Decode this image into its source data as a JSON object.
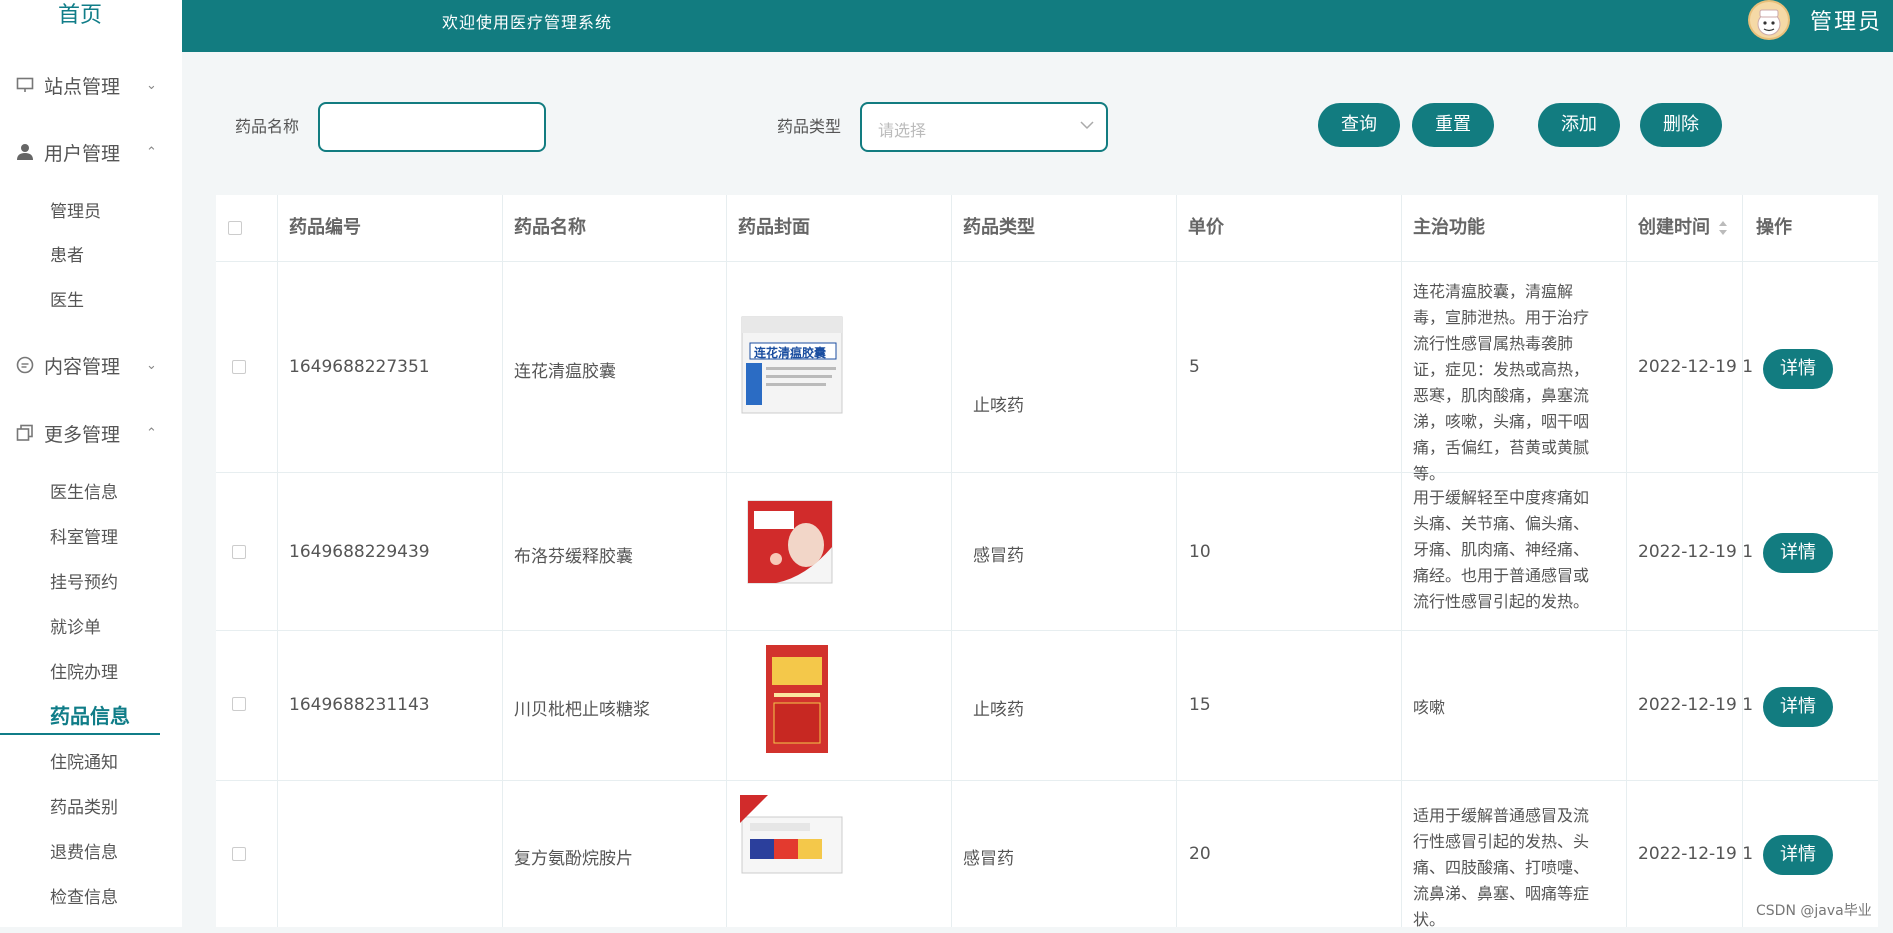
{
  "sidebar": {
    "title": "首页",
    "groups": [
      {
        "label": "站点管理",
        "icon": "monitor-icon",
        "chevron": "⌄"
      },
      {
        "label": "用户管理",
        "icon": "user-icon",
        "chevron": "⌃"
      },
      {
        "label": "内容管理",
        "icon": "chat-icon",
        "chevron": "⌄"
      },
      {
        "label": "更多管理",
        "icon": "copy-icon",
        "chevron": "⌃"
      }
    ],
    "user_items": [
      "管理员",
      "患者",
      "医生"
    ],
    "more_items": [
      "医生信息",
      "科室管理",
      "挂号预约",
      "就诊单",
      "住院办理",
      "药品信息",
      "住院通知",
      "药品类别",
      "退费信息",
      "检查信息"
    ]
  },
  "topbar": {
    "welcome": "欢迎使用医疗管理系统",
    "admin_name": "管理员"
  },
  "search": {
    "name_label": "药品名称",
    "name_value": "",
    "type_label": "药品类型",
    "type_placeholder": "请选择",
    "query": "查询",
    "reset": "重置",
    "add": "添加",
    "delete": "删除"
  },
  "table": {
    "headers": [
      "药品编号",
      "药品名称",
      "药品封面",
      "药品类型",
      "单价",
      "主治功能",
      "创建时间",
      "操作"
    ],
    "rows": [
      {
        "id": "1649688227351",
        "name": "连花清瘟胶囊",
        "type": "止咳药",
        "price": "5",
        "function": "连花清瘟胶囊，清瘟解毒，宣肺泄热。用于治疗流行性感冒属热毒袭肺证，症见：发热或高热，恶寒，肌肉酸痛，鼻塞流涕，咳嗽，头痛，咽干咽痛，舌偏红，苔黄或黄腻等。",
        "created": "2022-12-19 1",
        "action": "详情",
        "cover_text": "连花清瘟胶囊"
      },
      {
        "id": "1649688229439",
        "name": "布洛芬缓释胶囊",
        "type": "感冒药",
        "price": "10",
        "function": "用于缓解轻至中度疼痛如头痛、关节痛、偏头痛、牙痛、肌肉痛、神经痛、痛经。也用于普通感冒或流行性感冒引起的发热。",
        "created": "2022-12-19 1",
        "action": "详情",
        "cover_text": ""
      },
      {
        "id": "1649688231143",
        "name": "川贝枇杷止咳糖浆",
        "type": "止咳药",
        "price": "15",
        "function": "咳嗽",
        "created": "2022-12-19 1",
        "action": "详情",
        "cover_text": ""
      },
      {
        "id": "",
        "name": "复方氨酚烷胺片",
        "type": "感冒药",
        "price": "20",
        "function": "适用于缓解普通感冒及流行性感冒引起的发热、头痛、四肢酸痛、打喷嚏、流鼻涕、鼻塞、咽痛等症状。",
        "created": "2022-12-19 1",
        "action": "详情",
        "cover_text": ""
      }
    ]
  },
  "watermark": "CSDN @java毕业",
  "colors": {
    "primary": "#127c80",
    "background": "#f3f6f7"
  }
}
